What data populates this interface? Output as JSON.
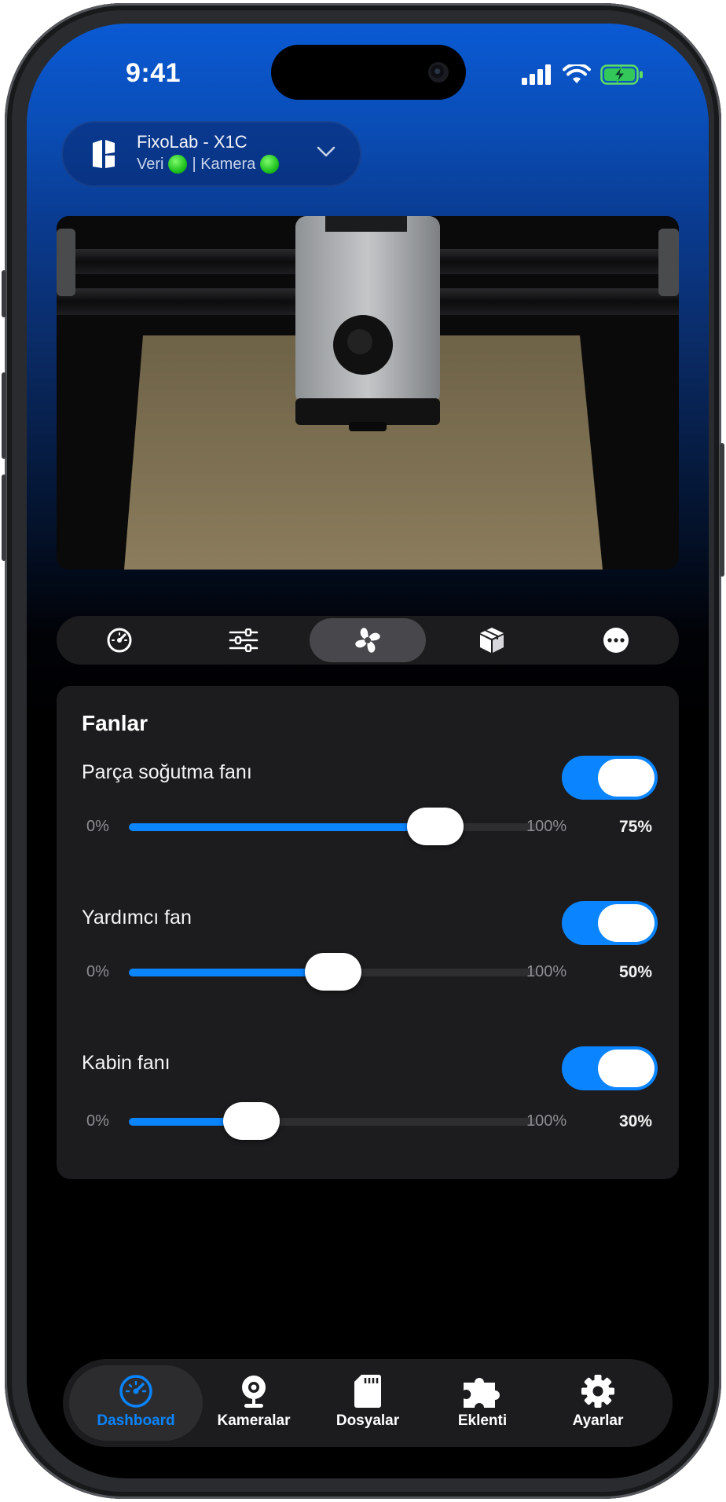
{
  "status_bar": {
    "time": "9:41"
  },
  "printer": {
    "name": "FixoLab - X1C",
    "data_label": "Veri",
    "camera_label": "| Kamera",
    "data_status_color": "#22c722",
    "camera_status_color": "#22c722"
  },
  "control_tabs": [
    {
      "icon": "speedometer-icon",
      "active": false
    },
    {
      "icon": "sliders-icon",
      "active": false
    },
    {
      "icon": "fan-icon",
      "active": true
    },
    {
      "icon": "box-icon",
      "active": false
    },
    {
      "icon": "more-icon",
      "active": false
    }
  ],
  "fans_card": {
    "title": "Fanlar",
    "fans": [
      {
        "name": "Parça soğutma fanı",
        "enabled": true,
        "min_label": "0%",
        "max_label": "100%",
        "value_label": "75%",
        "value": 75
      },
      {
        "name": "Yardımcı fan",
        "enabled": true,
        "min_label": "0%",
        "max_label": "100%",
        "value_label": "50%",
        "value": 50
      },
      {
        "name": "Kabin fanı",
        "enabled": true,
        "min_label": "0%",
        "max_label": "100%",
        "value_label": "30%",
        "value": 30
      }
    ]
  },
  "tab_bar": [
    {
      "label": "Dashboard",
      "icon": "dashboard-icon",
      "active": true
    },
    {
      "label": "Kameralar",
      "icon": "webcam-icon",
      "active": false
    },
    {
      "label": "Dosyalar",
      "icon": "sd-card-icon",
      "active": false
    },
    {
      "label": "Eklenti",
      "icon": "puzzle-icon",
      "active": false
    },
    {
      "label": "Ayarlar",
      "icon": "gear-icon",
      "active": false
    }
  ],
  "colors": {
    "accent": "#0a84ff",
    "card": "#1c1c1e",
    "toggle_on": "#0a84ff"
  }
}
